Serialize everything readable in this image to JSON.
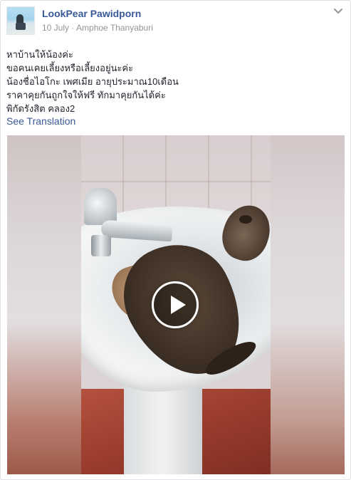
{
  "post": {
    "author": "LookPear Pawidporn",
    "date": "10 July",
    "separator": "·",
    "location": "Amphoe Thanyaburi",
    "message_lines": [
      "หาบ้านให้น้องค่ะ",
      "ขอคนเคยเลี้ยงหรือเลี้ยงอยู่นะค่ะ",
      "น้องชื่อไอโกะ เพศเมีย อายุประมาณ10เดือน",
      "ราคาคุยกันถูกใจให้ฟรี ทักมาคุยกันได้ค่ะ",
      "พิกัดรังสิต คลอง2"
    ],
    "see_translation": "See Translation",
    "icons": {
      "options": "chevron-down-icon",
      "media_control": "play-icon"
    }
  },
  "colors": {
    "link": "#385898",
    "meta_text": "#90949c",
    "body_text": "#1d2129"
  }
}
